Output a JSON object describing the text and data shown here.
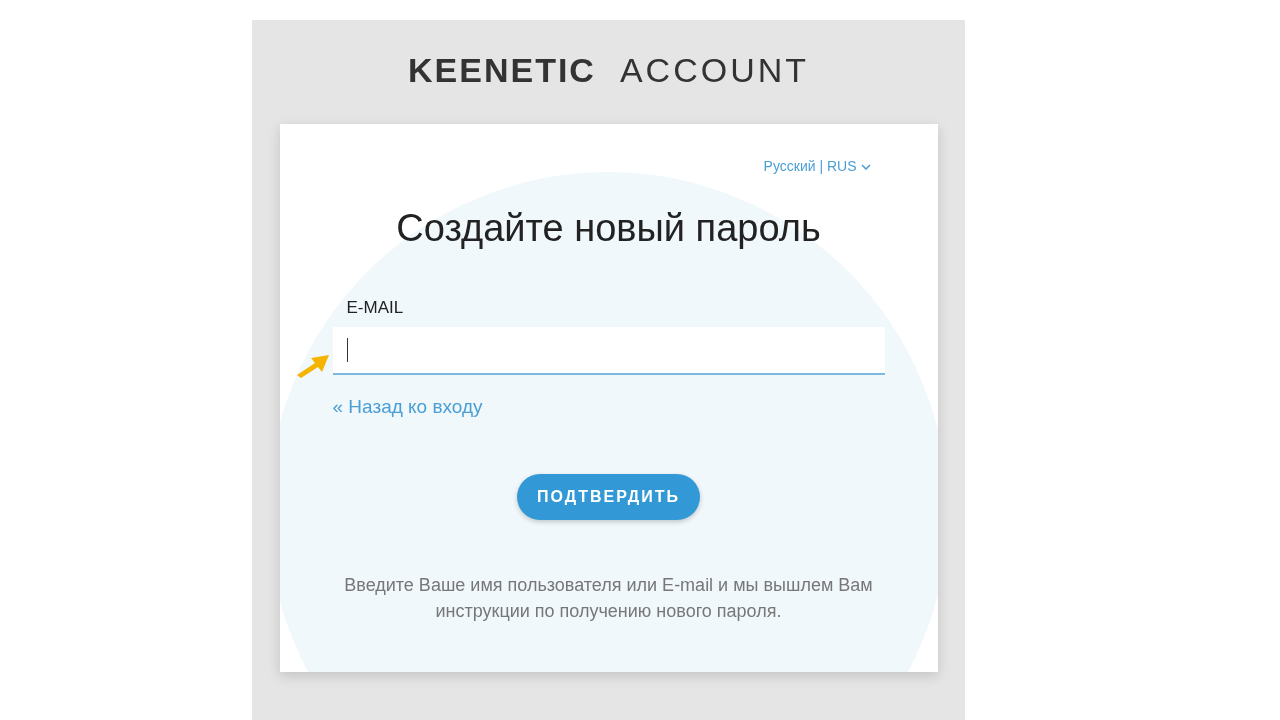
{
  "logo": {
    "brand": "KEENETIC",
    "product": "ACCOUNT"
  },
  "language": {
    "label": "Русский | RUS"
  },
  "title": "Создайте новый пароль",
  "email_field": {
    "label": "E-MAIL",
    "focused": true
  },
  "back_link": "« Назад ко входу",
  "submit_button": "ПОДТВЕРДИТЬ",
  "hint": "Введите Ваше имя пользователя или E-mail и мы вышлем Вам инструкции по получению нового пароля."
}
